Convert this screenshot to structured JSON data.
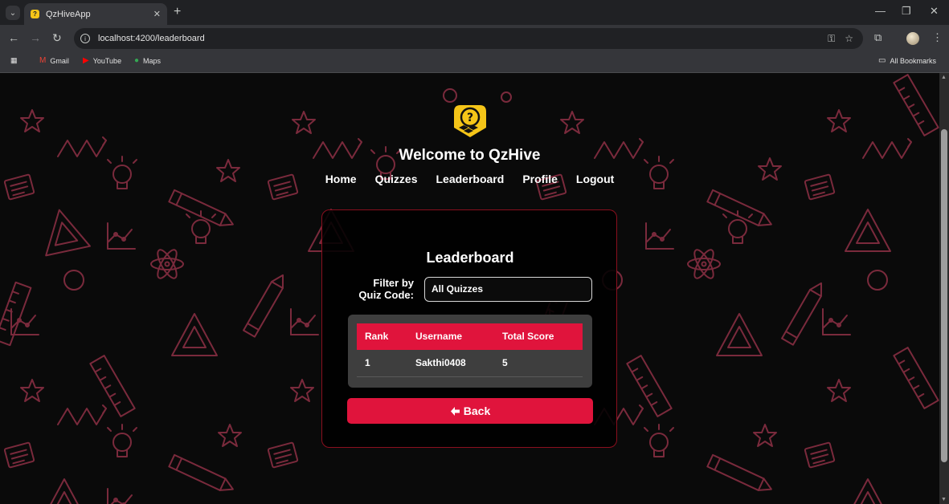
{
  "browser": {
    "tab_title": "QzHiveApp",
    "url": "localhost:4200/leaderboard",
    "bookmarks": [
      "Gmail",
      "YouTube",
      "Maps"
    ],
    "all_bookmarks": "All Bookmarks"
  },
  "header": {
    "welcome": "Welcome to QzHive",
    "nav": [
      "Home",
      "Quizzes",
      "Leaderboard",
      "Profile",
      "Logout"
    ]
  },
  "leaderboard": {
    "title": "Leaderboard",
    "filter_label": "Filter by Quiz Code:",
    "filter_value": "All Quizzes",
    "columns": [
      "Rank",
      "Username",
      "Total Score"
    ],
    "rows": [
      {
        "rank": "1",
        "username": "Sakthi0408",
        "score": "5"
      }
    ],
    "back_label": "Back"
  },
  "colors": {
    "accent": "#e0143c",
    "doodle": "#7a2a3c",
    "logo": "#f5c518"
  }
}
